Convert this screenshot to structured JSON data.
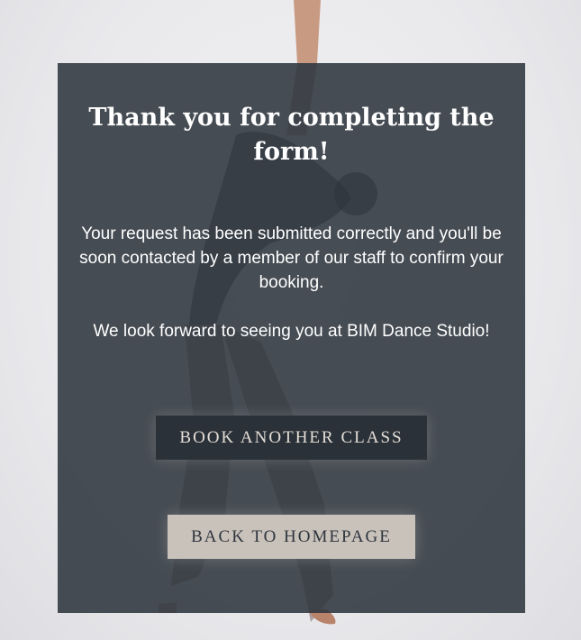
{
  "confirmation": {
    "title": "Thank you for completing the form!",
    "message": "Your request has been submitted correctly and you'll be soon contacted by a member of our staff to confirm your booking.",
    "closing": "We look forward to seeing you at BIM Dance Studio!"
  },
  "actions": {
    "book_another_label": "BOOK ANOTHER CLASS",
    "back_home_label": "BACK TO HOMEPAGE"
  },
  "colors": {
    "panel": "#2f353e",
    "book_button_bg": "#2b3138",
    "home_button_bg": "#c9c2bb",
    "background": "#ececef"
  }
}
